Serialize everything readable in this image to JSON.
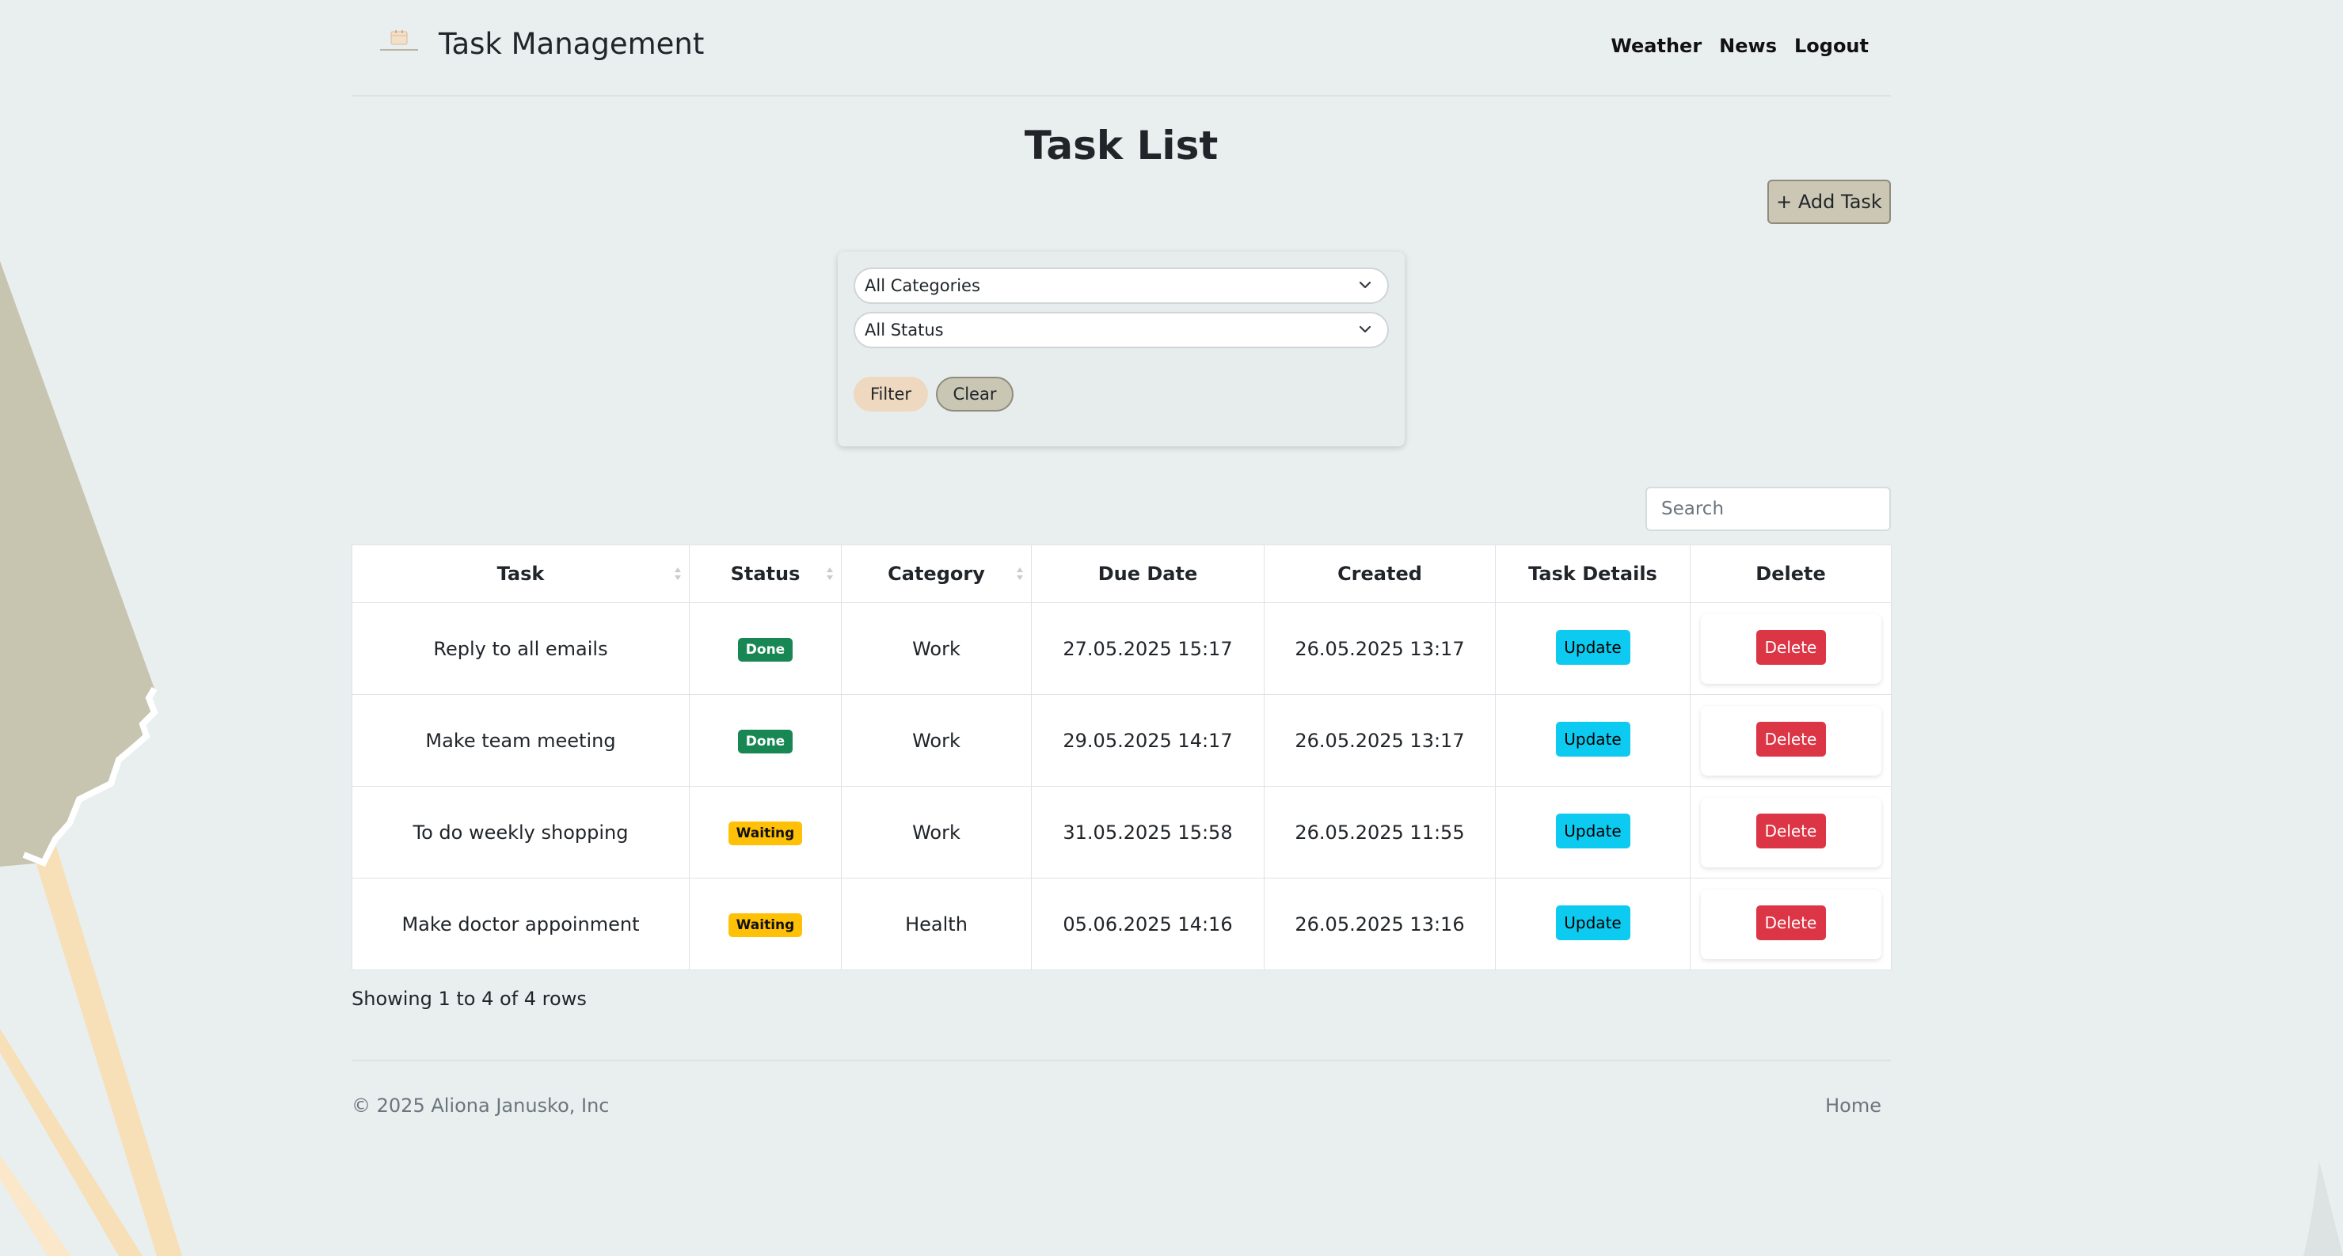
{
  "header": {
    "brand_title": "Task Management",
    "nav": [
      {
        "label": "Weather"
      },
      {
        "label": "News"
      },
      {
        "label": "Logout"
      }
    ]
  },
  "page_title": "Task List",
  "add_task_label": "+ Add Task",
  "filters": {
    "category_selected": "All Categories",
    "status_selected": "All Status",
    "filter_label": "Filter",
    "clear_label": "Clear"
  },
  "search": {
    "placeholder": "Search"
  },
  "table": {
    "columns": [
      "Task",
      "Status",
      "Category",
      "Due Date",
      "Created",
      "Task Details",
      "Delete"
    ],
    "rows": [
      {
        "task": "Reply to all emails",
        "status": "Done",
        "category": "Work",
        "due": "27.05.2025 15:17",
        "created": "26.05.2025 13:17",
        "update_label": "Update",
        "delete_label": "Delete"
      },
      {
        "task": "Make team meeting",
        "status": "Done",
        "category": "Work",
        "due": "29.05.2025 14:17",
        "created": "26.05.2025 13:17",
        "update_label": "Update",
        "delete_label": "Delete"
      },
      {
        "task": "To do weekly shopping",
        "status": "Waiting",
        "category": "Work",
        "due": "31.05.2025 15:58",
        "created": "26.05.2025 11:55",
        "update_label": "Update",
        "delete_label": "Delete"
      },
      {
        "task": "Make doctor appoinment",
        "status": "Waiting",
        "category": "Health",
        "due": "05.06.2025 14:16",
        "created": "26.05.2025 13:16",
        "update_label": "Update",
        "delete_label": "Delete"
      }
    ]
  },
  "pagination_text": "Showing 1 to 4 of 4 rows",
  "footer": {
    "copyright": "© 2025 Aliona Janusko, Inc",
    "home_label": "Home"
  },
  "colors": {
    "page_bg": "#e9efef",
    "done": "#198754",
    "waiting": "#ffc107",
    "update": "#0dcaf0",
    "delete": "#dc3545"
  },
  "icons": {
    "brand": "calendar-logo-icon",
    "select_arrow": "chevron-down-icon",
    "sort": "sort-icon"
  }
}
